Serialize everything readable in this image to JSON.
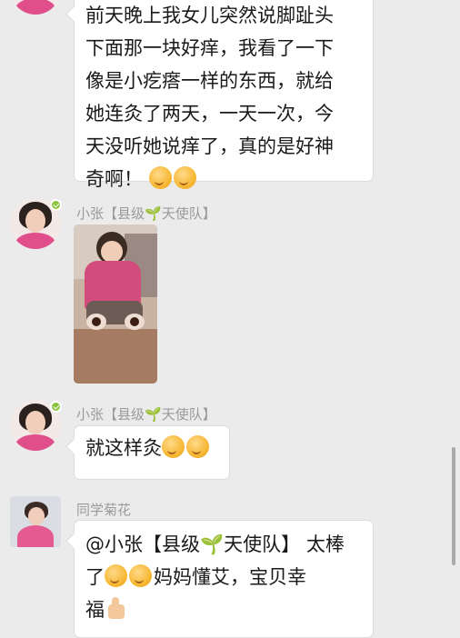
{
  "messages": [
    {
      "type": "text",
      "text_lines": [
        "前天晚上我女儿突然说脚趾头",
        "下面那一块好痒，我看了一下",
        "像是小疙瘩一样的东西，就给",
        "她连灸了两天，一天一次，今",
        "天没听她说痒了，真的是好神"
      ],
      "last_line": "奇啊！",
      "emoji": "grin-emoji"
    },
    {
      "type": "image",
      "sender_prefix": "小张【县级",
      "sender_sprout": "🌱",
      "sender_suffix": "天使队】"
    },
    {
      "type": "text",
      "sender_prefix": "小张【县级",
      "sender_sprout": "🌱",
      "sender_suffix": "天使队】",
      "text": "就这样灸",
      "emoji": "thinking-emoji"
    },
    {
      "type": "text",
      "sender": "同学菊花",
      "line1": "@小张【县级🌱天使队】 太棒",
      "line2_prefix": "了",
      "line2_suffix": "妈妈懂艾，宝贝幸",
      "line3": "福",
      "emoji": "grin-emoji",
      "end_icon": "thumbs-up-icon"
    }
  ]
}
